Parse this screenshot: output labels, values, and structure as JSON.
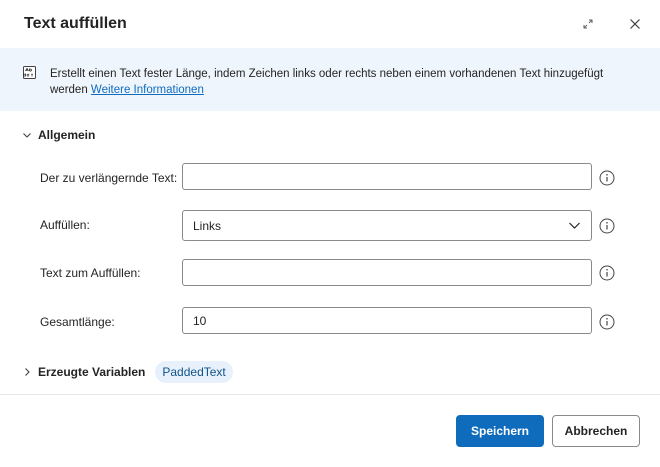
{
  "dialog": {
    "title": "Text auffüllen",
    "expand_icon": "expand-icon",
    "close_icon": "close-icon"
  },
  "info": {
    "icon": "text-action-icon",
    "text": "Erstellt einen Text fester Länge, indem Zeichen links oder rechts neben einem vorhandenen Text hinzugefügt werden",
    "link": "Weitere Informationen"
  },
  "section_general": {
    "label": "Allgemein",
    "expanded": true
  },
  "fields": {
    "text_to_pad": {
      "label": "Der zu verlängernde Text:",
      "value": ""
    },
    "pad": {
      "label": "Auffüllen:",
      "value": "Links"
    },
    "pad_text": {
      "label": "Text zum Auffüllen:",
      "value": ""
    },
    "total_length": {
      "label": "Gesamtlänge:",
      "value": "10"
    }
  },
  "variables": {
    "label": "Erzeugte Variablen",
    "items": [
      "PaddedText"
    ]
  },
  "footer": {
    "save_label": "Speichern",
    "cancel_label": "Abbrechen"
  },
  "colors": {
    "accent": "#0f6cbd",
    "info_background": "#eff5fc",
    "chip_background": "#e8f1fb"
  }
}
